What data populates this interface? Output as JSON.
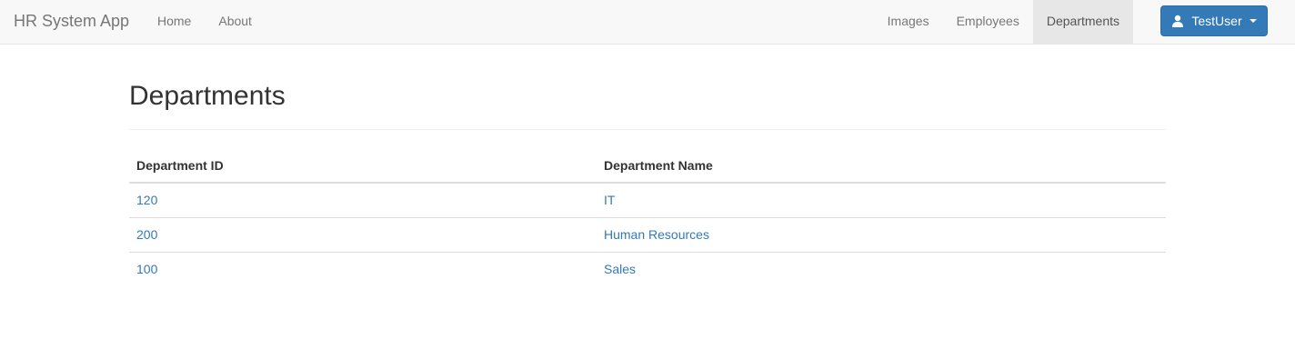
{
  "navbar": {
    "brand": "HR System App",
    "left_links": [
      {
        "label": "Home"
      },
      {
        "label": "About"
      }
    ],
    "right_links": [
      {
        "label": "Images"
      },
      {
        "label": "Employees"
      },
      {
        "label": "Departments",
        "active": true
      }
    ],
    "user": {
      "label": "TestUser",
      "icon": "user-icon"
    }
  },
  "page": {
    "title": "Departments"
  },
  "table": {
    "headers": [
      "Department ID",
      "Department Name"
    ],
    "rows": [
      {
        "id": "120",
        "name": "IT"
      },
      {
        "id": "200",
        "name": "Human Resources"
      },
      {
        "id": "100",
        "name": "Sales"
      }
    ]
  },
  "colors": {
    "accent": "#337ab7",
    "navbar_bg": "#f8f8f8",
    "active_bg": "#e7e7e7"
  }
}
